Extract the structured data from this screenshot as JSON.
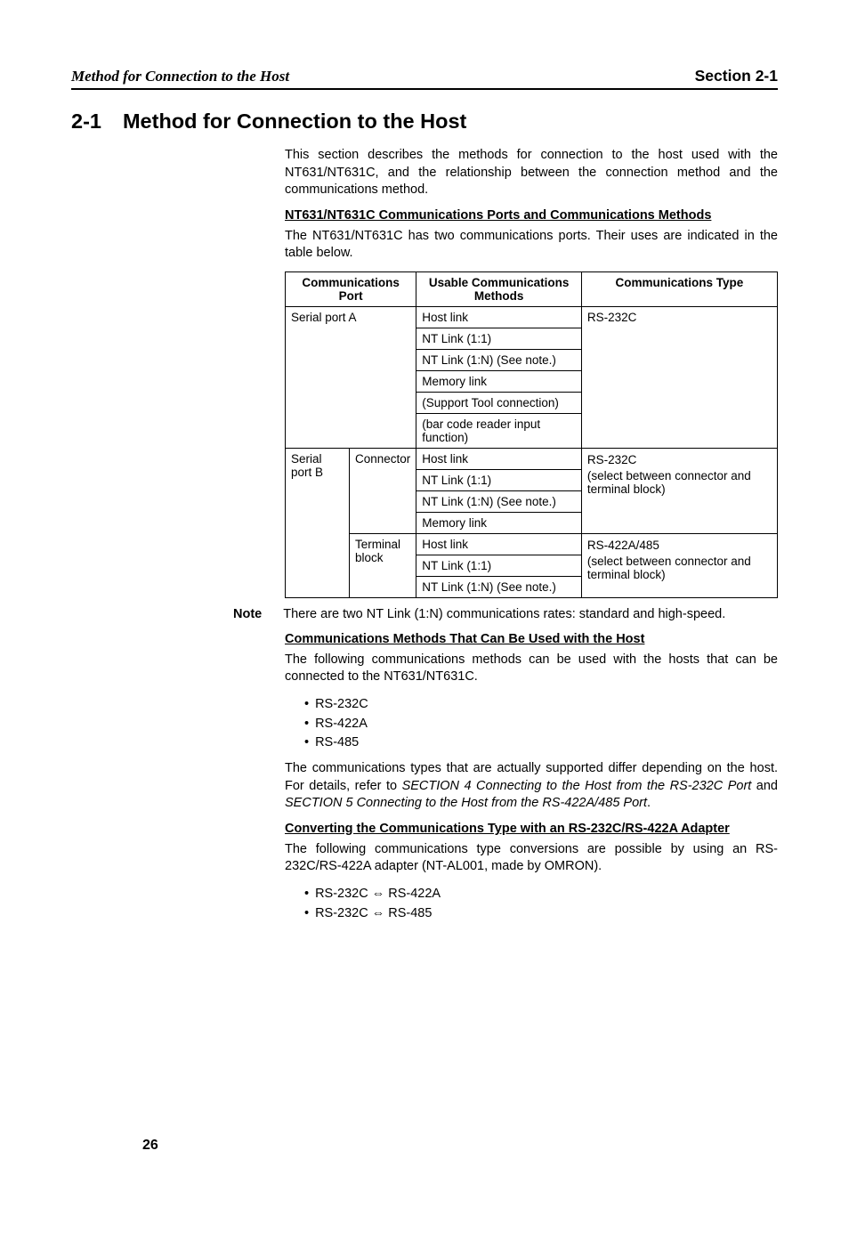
{
  "header": {
    "left": "Method for Connection to the Host",
    "right": "Section 2-1"
  },
  "section": {
    "number": "2-1",
    "title": "Method for Connection to the Host"
  },
  "intro": "This section describes the methods for connection to the host used with the NT631/NT631C, and the relationship between the connection method and the communications method.",
  "sub1": {
    "heading": "NT631/NT631C Communications Ports and Communications Methods",
    "para": "The NT631/NT631C has two communications ports. Their uses are indicated in the table below."
  },
  "table": {
    "headers": {
      "port": "Communications Port",
      "methods": "Usable Communications Methods",
      "type": "Communications Type"
    },
    "row1": {
      "port": "Serial port A",
      "m1": "Host link",
      "m2": "NT Link (1:1)",
      "m3": "NT Link (1:N) (See note.)",
      "m4": "Memory link",
      "m5": "(Support Tool connection)",
      "m6": "(bar code reader input function)",
      "type": "RS-232C"
    },
    "row2": {
      "port": "Serial port B",
      "sub1": "Connector",
      "sub1_m1": "Host link",
      "sub1_m2": "NT Link (1:1)",
      "sub1_m3": "NT Link (1:N) (See note.)",
      "sub1_m4": "Memory link",
      "sub1_type1": "RS-232C",
      "sub1_type2": "(select between connector and terminal block)",
      "sub2": "Terminal block",
      "sub2_m1": "Host link",
      "sub2_m2": "NT Link (1:1)",
      "sub2_m3": "NT Link (1:N) (See note.)",
      "sub2_type1": "RS-422A/485",
      "sub2_type2": "(select between connector and terminal block)"
    }
  },
  "note": {
    "label": "Note",
    "text": "There are two NT Link (1:N) communications rates: standard and high-speed."
  },
  "sub2": {
    "heading": "Communications Methods That Can Be Used with the Host",
    "para": "The following communications methods can be used with the hosts that can be connected to the NT631/NT631C.",
    "bullets": [
      "RS-232C",
      "RS-422A",
      "RS-485"
    ],
    "para2a": "The communications types that are actually supported differ depending on the host. For details, refer to ",
    "para2b": "SECTION 4 Connecting to the Host from the RS-232C Port",
    "para2c": " and ",
    "para2d": "SECTION 5 Connecting to the Host from the RS-422A/485 Port",
    "para2e": "."
  },
  "sub3": {
    "heading": "Converting the Communications Type with an RS-232C/RS-422A Adapter",
    "para": "The following communications type conversions are possible by using an RS-232C/RS-422A adapter (NT-AL001, made by OMRON).",
    "bullets": [
      "RS-232C ⇔ RS-422A",
      "RS-232C ⇔ RS-485"
    ]
  },
  "pagenum": "26"
}
